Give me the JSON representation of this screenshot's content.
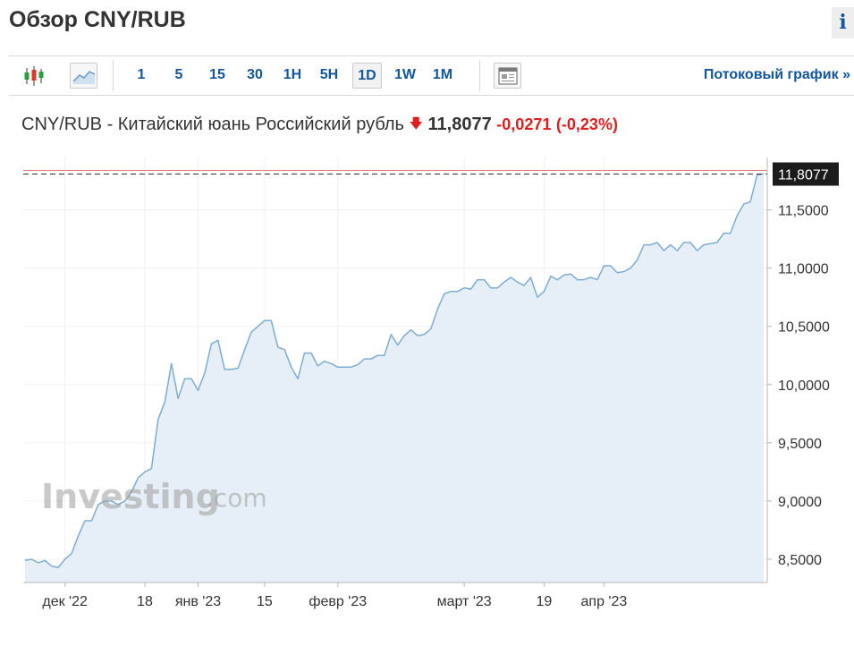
{
  "page": {
    "title": "Обзор CNY/RUB",
    "info_label": "i"
  },
  "toolbar": {
    "timeframes": [
      "1",
      "5",
      "15",
      "30",
      "1H",
      "5H",
      "1D",
      "1W",
      "1M"
    ],
    "active_timeframe": "1D",
    "stream_link": "Потоковый график »",
    "icons": [
      "candlestick-icon",
      "area-chart-icon",
      "news-panel-icon"
    ]
  },
  "quote": {
    "instrument": "CNY/RUB - Китайский юань Российский рубль",
    "price": "11,8077",
    "change": "-0,0271",
    "change_pct": "(-0,23%)",
    "direction": "down"
  },
  "colors": {
    "line": "#7eadd3",
    "area": "#e3edf6",
    "negative": "#e01e1e",
    "link": "#1256a0",
    "price_box": "#1b1b1b"
  },
  "watermark": {
    "brand": "Investing",
    "suffix": ".com"
  },
  "chart_data": {
    "type": "area",
    "title": "",
    "xlabel": "",
    "ylabel": "",
    "ylim": [
      8.3,
      11.95
    ],
    "y_ticks": [
      "11,5000",
      "11,0000",
      "10,5000",
      "10,0000",
      "9,5000",
      "9,0000",
      "8,5000"
    ],
    "y_tick_values": [
      11.5,
      11.0,
      10.5,
      10.0,
      9.5,
      9.0,
      8.5
    ],
    "x_ticks": [
      {
        "label": "дек '22",
        "index": 6
      },
      {
        "label": "18",
        "index": 18
      },
      {
        "label": "янв '23",
        "index": 26
      },
      {
        "label": "15",
        "index": 36
      },
      {
        "label": "февр '23",
        "index": 47
      },
      {
        "label": "март '23",
        "index": 66
      },
      {
        "label": "19",
        "index": 78
      },
      {
        "label": "апр '23",
        "index": 87
      }
    ],
    "last_value": 11.8077,
    "last_label": "11,8077",
    "series": [
      {
        "values": [
          8.49,
          8.5,
          8.47,
          8.49,
          8.44,
          8.43,
          8.5,
          8.55,
          8.7,
          8.83,
          8.83,
          8.97,
          9.0,
          9.0,
          8.97,
          9.0,
          9.08,
          9.2,
          9.25,
          9.28,
          9.7,
          9.85,
          10.18,
          9.88,
          10.05,
          10.05,
          9.95,
          10.1,
          10.35,
          10.38,
          10.13,
          10.13,
          10.14,
          10.3,
          10.45,
          10.5,
          10.55,
          10.55,
          10.32,
          10.3,
          10.15,
          10.05,
          10.27,
          10.27,
          10.16,
          10.2,
          10.18,
          10.15,
          10.15,
          10.15,
          10.17,
          10.22,
          10.22,
          10.25,
          10.25,
          10.43,
          10.34,
          10.42,
          10.47,
          10.42,
          10.43,
          10.48,
          10.65,
          10.78,
          10.8,
          10.8,
          10.83,
          10.82,
          10.9,
          10.9,
          10.83,
          10.83,
          10.88,
          10.92,
          10.88,
          10.85,
          10.92,
          10.75,
          10.8,
          10.93,
          10.9,
          10.94,
          10.95,
          10.9,
          10.9,
          10.92,
          10.9,
          11.02,
          11.02,
          10.96,
          10.97,
          11.0,
          11.07,
          11.2,
          11.2,
          11.22,
          11.15,
          11.2,
          11.15,
          11.22,
          11.22,
          11.15,
          11.2,
          11.21,
          11.22,
          11.3,
          11.3,
          11.45,
          11.55,
          11.57,
          11.8,
          11.81
        ]
      }
    ]
  }
}
